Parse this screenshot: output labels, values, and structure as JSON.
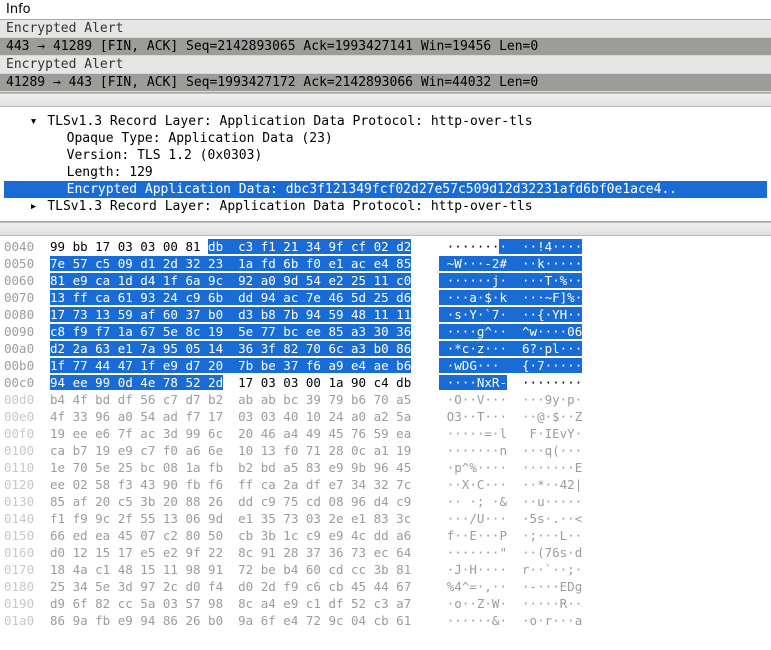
{
  "info_header": "Info",
  "packet_rows": [
    {
      "cls": "light",
      "text": "Encrypted Alert"
    },
    {
      "cls": "dark",
      "text": "443 → 41289 [FIN, ACK] Seq=2142893065 Ack=1993427141 Win=19456 Len=0"
    },
    {
      "cls": "light",
      "text": "Encrypted Alert"
    },
    {
      "cls": "dark",
      "text": "41289 → 443 [FIN, ACK] Seq=1993427172 Ack=2142893066 Win=44032 Len=0"
    }
  ],
  "tree": {
    "l1_twisty": "▾",
    "l1": "TLSv1.3 Record Layer: Application Data Protocol: http-over-tls",
    "l2a": "Opaque Type: Application Data (23)",
    "l2b": "Version: TLS 1.2 (0x0303)",
    "l2c": "Length: 129",
    "l2d": "Encrypted Application Data: dbc3f121349fcf02d27e57c509d12d32231afd6bf0e1ace4..",
    "l3_twisty": "▸",
    "l3": "TLSv1.3 Record Layer: Application Data Protocol: http-over-tls"
  },
  "hex_rows": [
    {
      "off": "0040",
      "dim": false,
      "pre": "99 bb 17 03 03 00 81 ",
      "hl": "db  c3 f1 21 34 9f cf 02 d2",
      "apre": " ·······",
      "ahl": "·  ··!4····"
    },
    {
      "off": "0050",
      "dim": false,
      "pre": "",
      "hl": "7e 57 c5 09 d1 2d 32 23  1a fd 6b f0 e1 ac e4 85",
      "apre": "",
      "ahl": " ~W···-2#  ··k·····"
    },
    {
      "off": "0060",
      "dim": false,
      "pre": "",
      "hl": "81 e9 ca 1d d4 1f 6a 9c  92 a0 9d 54 e2 25 11 c0",
      "apre": "",
      "ahl": " ······j·  ···T·%··"
    },
    {
      "off": "0070",
      "dim": false,
      "pre": "",
      "hl": "13 ff ca 61 93 24 c9 6b  dd 94 ac 7e 46 5d 25 d6",
      "apre": "",
      "ahl": " ···a·$·k  ···~F]%·"
    },
    {
      "off": "0080",
      "dim": false,
      "pre": "",
      "hl": "17 73 13 59 af 60 37 b0  d3 b8 7b 94 59 48 11 11",
      "apre": "",
      "ahl": " ·s·Y·`7·  ··{·YH··"
    },
    {
      "off": "0090",
      "dim": false,
      "pre": "",
      "hl": "c8 f9 f7 1a 67 5e 8c 19  5e 77 bc ee 85 a3 30 36",
      "apre": "",
      "ahl": " ····g^··  ^w····06"
    },
    {
      "off": "00a0",
      "dim": false,
      "pre": "",
      "hl": "d2 2a 63 e1 7a 95 05 14  36 3f 82 70 6c a3 b0 86",
      "apre": "",
      "ahl": " ·*c·z···  6?·pl···"
    },
    {
      "off": "00b0",
      "dim": false,
      "pre": "",
      "hl": "1f 77 44 47 1f e9 d7 20  7b be 37 f6 a9 e4 ae b6",
      "apre": "",
      "ahl": " ·wDG···   {·7·····"
    },
    {
      "off": "00c0",
      "dim": false,
      "pre": "",
      "hl": "94 ee 99 0d 4e 78 52 2d",
      "post": "  17 03 03 00 1a 90 c4 db",
      "apre": "",
      "ahl": " ····NxR-",
      "apost": "  ········"
    },
    {
      "off": "00d0",
      "dim": true,
      "pre": "b4 4f bd df 56 c7 d7 b2  ab ab bc 39 79 b6 70 a5",
      "apre": " ·O··V···  ···9y·p·"
    },
    {
      "off": "00e0",
      "dim": true,
      "pre": "4f 33 96 a0 54 ad f7 17  03 03 40 10 24 a0 a2 5a",
      "apre": " O3··T···  ··@·$··Z"
    },
    {
      "off": "00f0",
      "dim": true,
      "pre": "19 ee e6 7f ac 3d 99 6c  20 46 a4 49 45 76 59 ea",
      "apre": " ·····=·l   F·IEvY·"
    },
    {
      "off": "0100",
      "dim": true,
      "pre": "ca b7 19 e9 c7 f0 a6 6e  10 13 f0 71 28 0c a1 19",
      "apre": " ·······n  ···q(···"
    },
    {
      "off": "0110",
      "dim": true,
      "pre": "1e 70 5e 25 bc 08 1a fb  b2 bd a5 83 e9 9b 96 45",
      "apre": " ·p^%····  ·······E"
    },
    {
      "off": "0120",
      "dim": true,
      "pre": "ee 02 58 f3 43 90 fb f6  ff ca 2a df e7 34 32 7c",
      "apre": " ··X·C···  ··*··42|"
    },
    {
      "off": "0130",
      "dim": true,
      "pre": "85 af 20 c5 3b 20 88 26  dd c9 75 cd 08 96 d4 c9",
      "apre": " ·· ·; ·&  ··u·····"
    },
    {
      "off": "0140",
      "dim": true,
      "pre": "f1 f9 9c 2f 55 13 06 9d  e1 35 73 03 2e e1 83 3c",
      "apre": " ···/U···  ·5s·.··<"
    },
    {
      "off": "0150",
      "dim": true,
      "pre": "66 ed ea 45 07 c2 80 50  cb 3b 1c c9 e9 4c dd a6",
      "apre": " f··E···P  ·;···L··"
    },
    {
      "off": "0160",
      "dim": true,
      "pre": "d0 12 15 17 e5 e2 9f 22  8c 91 28 37 36 73 ec 64",
      "apre": " ·······\"  ··(76s·d"
    },
    {
      "off": "0170",
      "dim": true,
      "pre": "18 4a c1 48 15 11 98 91  72 be b4 60 cd cc 3b 81",
      "apre": " ·J·H····  r··`··;·"
    },
    {
      "off": "0180",
      "dim": true,
      "pre": "25 34 5e 3d 97 2c d0 f4  d0 2d f9 c6 cb 45 44 67",
      "apre": " %4^=·,··  ·-···EDg"
    },
    {
      "off": "0190",
      "dim": true,
      "pre": "d9 6f 82 cc 5a 03 57 98  8c a4 e9 c1 df 52 c3 a7",
      "apre": " ·o··Z·W·  ·····R··"
    },
    {
      "off": "01a0",
      "dim": true,
      "pre": "86 9a fb e9 94 86 26 b0  9a 6f e4 72 9c 04 cb 61",
      "apre": " ······&·  ·o·r···a"
    }
  ]
}
